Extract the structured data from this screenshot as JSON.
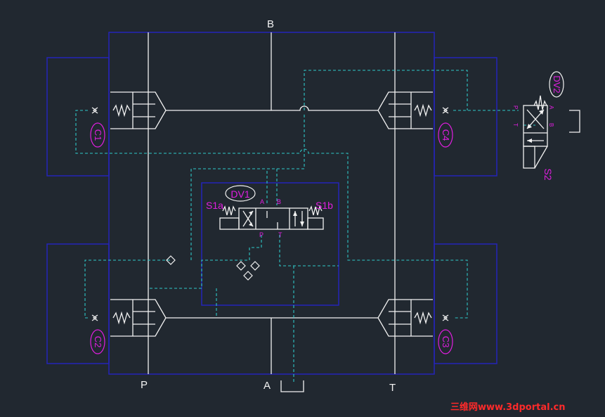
{
  "colors": {
    "background": "#212830",
    "main_line": "#f2f2f2",
    "pilot_line": "#2fc7c7",
    "block_outline": "#2424b8",
    "label": "#e01ee0",
    "watermark": "#ff2a2a"
  },
  "ports": {
    "b": "B",
    "p": "P",
    "a": "A",
    "t": "T"
  },
  "cartridges": {
    "c1": "C1",
    "c2": "C2",
    "c3": "C3",
    "c4": "C4"
  },
  "valve_dv1": {
    "name": "DV1",
    "solenoid_a": "S1a",
    "solenoid_b": "S1b",
    "port_a": "A",
    "port_b": "B",
    "port_p": "P",
    "port_t": "T"
  },
  "valve_dv2": {
    "name": "DV2",
    "solenoid": "S2",
    "port_p": "P",
    "port_a": "A",
    "port_t": "T",
    "port_b": "B"
  },
  "watermark": "三维网www.3dportal.cn"
}
